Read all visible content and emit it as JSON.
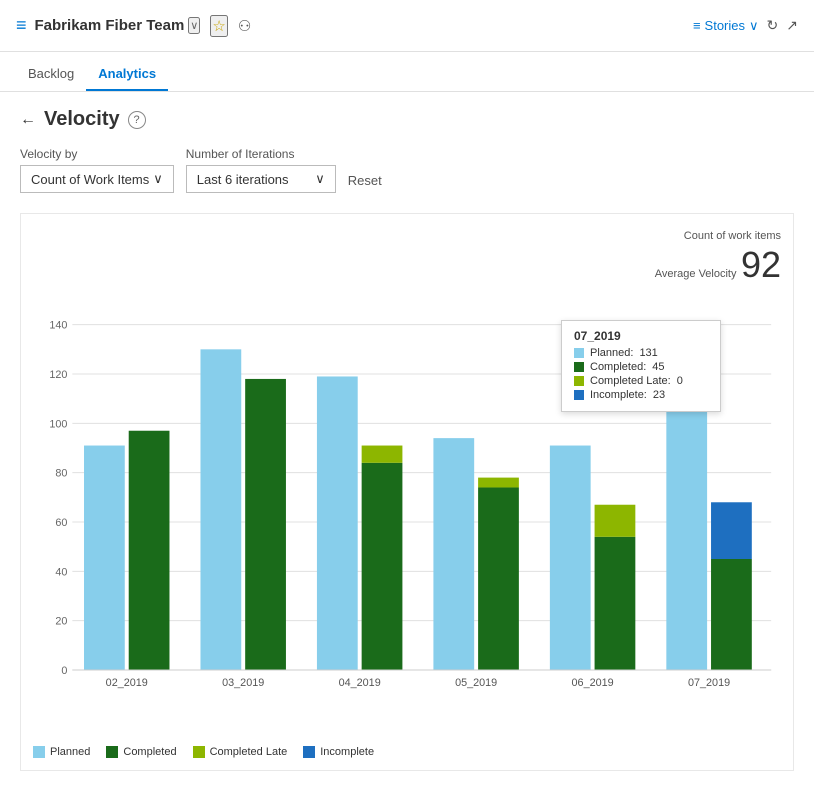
{
  "header": {
    "icon": "≡",
    "team_name": "Fabrikam Fiber Team",
    "chevron": "∨",
    "star": "☆",
    "team_members_icon": "👥",
    "stories_label": "Stories",
    "refresh_icon": "↻",
    "expand_icon": "↗"
  },
  "nav": {
    "tabs": [
      {
        "id": "backlog",
        "label": "Backlog",
        "active": false
      },
      {
        "id": "analytics",
        "label": "Analytics",
        "active": true
      }
    ]
  },
  "page": {
    "back_icon": "←",
    "title": "Velocity",
    "help_icon": "?"
  },
  "filters": {
    "velocity_by_label": "Velocity by",
    "velocity_by_value": "Count of Work Items",
    "iterations_label": "Number of Iterations",
    "iterations_value": "Last 6 iterations",
    "reset_label": "Reset"
  },
  "chart": {
    "summary_label1": "Count of work items",
    "summary_label2": "Average Velocity",
    "summary_value": "92",
    "y_axis_labels": [
      "0",
      "20",
      "40",
      "60",
      "80",
      "100",
      "120",
      "140"
    ],
    "bars": [
      {
        "sprint": "02_2019",
        "planned": 91,
        "completed": 97,
        "completed_late": 0,
        "incomplete": 0
      },
      {
        "sprint": "03_2019",
        "planned": 130,
        "completed": 118,
        "completed_late": 0,
        "incomplete": 0
      },
      {
        "sprint": "04_2019",
        "planned": 119,
        "completed": 84,
        "completed_late": 7,
        "incomplete": 0
      },
      {
        "sprint": "05_2019",
        "planned": 94,
        "completed": 74,
        "completed_late": 4,
        "incomplete": 0
      },
      {
        "sprint": "06_2019",
        "planned": 91,
        "completed": 54,
        "completed_late": 13,
        "incomplete": 0
      },
      {
        "sprint": "07_2019",
        "planned": 131,
        "completed": 45,
        "completed_late": 0,
        "incomplete": 23
      }
    ],
    "tooltip": {
      "sprint": "07_2019",
      "planned_label": "Planned:",
      "planned_value": "131",
      "completed_label": "Completed:",
      "completed_value": "45",
      "completed_late_label": "Completed Late:",
      "completed_late_value": "0",
      "incomplete_label": "Incomplete:",
      "incomplete_value": "23"
    },
    "legend": [
      {
        "id": "planned",
        "label": "Planned",
        "color": "#add8e6"
      },
      {
        "id": "completed",
        "label": "Completed",
        "color": "#1a6b1a"
      },
      {
        "id": "completed_late",
        "label": "Completed Late",
        "color": "#8db600"
      },
      {
        "id": "incomplete",
        "label": "Incomplete",
        "color": "#1e6fc0"
      }
    ],
    "colors": {
      "planned": "#87ceeb",
      "completed": "#1a6b1a",
      "completed_late": "#8db600",
      "incomplete": "#1e6fc0"
    }
  }
}
